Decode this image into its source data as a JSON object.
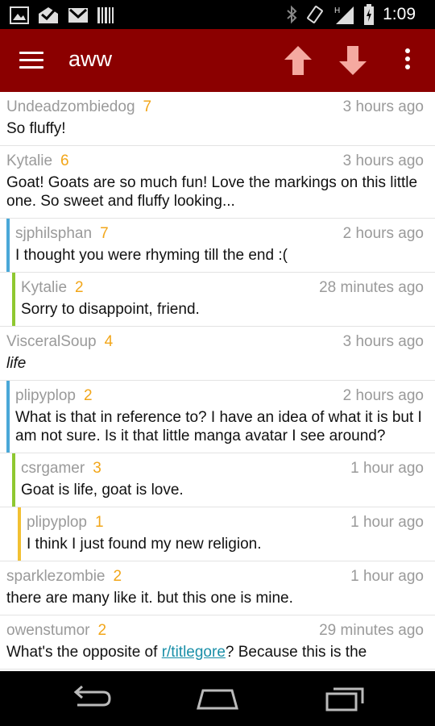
{
  "status_bar": {
    "time": "1:09",
    "icons": [
      "image-icon",
      "mail-check-icon",
      "gmail-icon",
      "barcode-icon",
      "bluetooth-icon",
      "vibrate-icon",
      "signal-icon",
      "battery-icon"
    ]
  },
  "action_bar": {
    "title": "aww",
    "colors": {
      "background": "#8b0000"
    }
  },
  "comments": [
    {
      "author": "Undeadzombiedog",
      "score": "7",
      "time": "3 hours ago",
      "body": "So fluffy!",
      "depth": 0
    },
    {
      "author": "Kytalie",
      "score": "6",
      "time": "3 hours ago",
      "body": "Goat! Goats are so much fun! Love the markings on this little one. So sweet and fluffy looking...",
      "depth": 0
    },
    {
      "author": "sjphilsphan",
      "score": "7",
      "time": "2 hours ago",
      "body": "I thought you were rhyming till the end :(",
      "depth": 1
    },
    {
      "author": "Kytalie",
      "score": "2",
      "time": "28 minutes ago",
      "body": "Sorry to disappoint, friend.",
      "depth": 2
    },
    {
      "author": "VisceralSoup",
      "score": "4",
      "time": "3 hours ago",
      "body": "life",
      "depth": 0
    },
    {
      "author": "plipyplop",
      "score": "2",
      "time": "2 hours ago",
      "body": "What is that in reference to? I have an idea of what it is but I am not sure. Is it that little manga avatar I see around?",
      "depth": 1
    },
    {
      "author": "csrgamer",
      "score": "3",
      "time": "1 hour ago",
      "body": "Goat is life, goat is love.",
      "depth": 2
    },
    {
      "author": "plipyplop",
      "score": "1",
      "time": "1 hour ago",
      "body": "I think I just found my new religion.",
      "depth": 3
    },
    {
      "author": "sparklezombie",
      "score": "2",
      "time": "1 hour ago",
      "body": "there are many like it. but this one is mine.",
      "depth": 0
    },
    {
      "author": "owenstumor",
      "score": "2",
      "time": "29 minutes ago",
      "body_before": "What's the opposite of ",
      "link": "r/titlegore",
      "body_after": "? Because this is the",
      "depth": 0
    }
  ],
  "colors": {
    "score": "#f2a619",
    "depth1_bar": "#4aa8d8",
    "depth2_bar": "#8fc830",
    "depth3_bar": "#f2c032",
    "link": "#1a8fa8"
  },
  "nav_bar": {
    "icons": [
      "back-icon",
      "home-icon",
      "recent-apps-icon"
    ]
  }
}
